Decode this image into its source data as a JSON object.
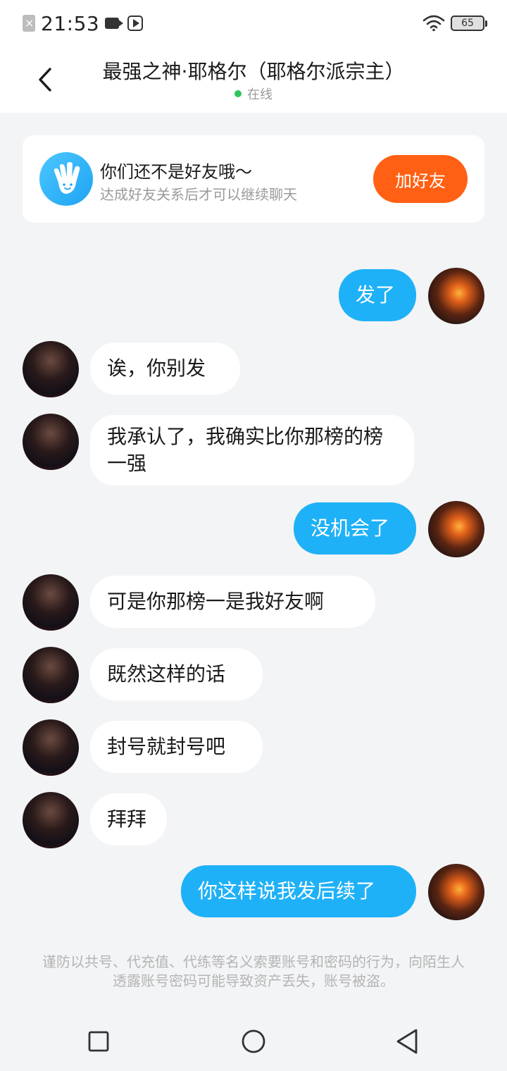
{
  "status_bar": {
    "time": "21:53",
    "battery": "65"
  },
  "header": {
    "title": "最强之神·耶格尔（耶格尔派宗主）",
    "status": "在线"
  },
  "friend_notice": {
    "title": "你们还不是好友哦～",
    "subtitle": "达成好友关系后才可以继续聊天",
    "add_button": "加好友"
  },
  "messages": [
    {
      "side": "me",
      "text": "发了"
    },
    {
      "side": "them",
      "text": "诶，你别发"
    },
    {
      "side": "them",
      "text": "我承认了，我确实比你那榜的榜一强"
    },
    {
      "side": "me",
      "text": "没机会了"
    },
    {
      "side": "them",
      "text": "可是你那榜一是我好友啊"
    },
    {
      "side": "them",
      "text": "既然这样的话"
    },
    {
      "side": "them",
      "text": "封号就封号吧"
    },
    {
      "side": "them",
      "text": "拜拜"
    },
    {
      "side": "me",
      "text": "你这样说我发后续了"
    }
  ],
  "warning": "谨防以共号、代充值、代练等名义索要账号和密码的行为，向陌生人透露账号密码可能导致资产丢失，账号被盗。",
  "colors": {
    "accent": "#1fb1f7",
    "add_button": "#ff6014",
    "online": "#2ec45a"
  },
  "icons": [
    "back-icon",
    "wave-hand-icon",
    "square-nav-icon",
    "circle-nav-icon",
    "triangle-nav-icon"
  ]
}
